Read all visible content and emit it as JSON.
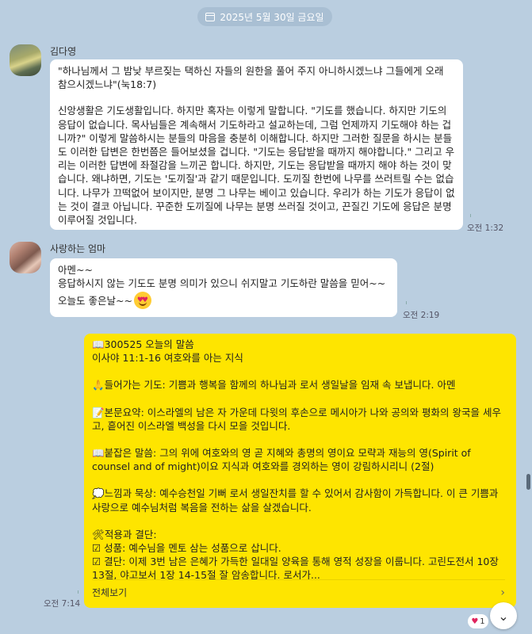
{
  "date_divider": "2025년 5월 30일 금요일",
  "messages": [
    {
      "sender": "김다영",
      "paragraphs": [
        "\"하나님께서 그 밤낮 부르짖는 택하신 자들의 원한을 풀어 주지 아니하시겠느냐 그들에게 오래 참으시겠느냐\"(눅18:7)",
        "신앙생활은 기도생활입니다. 하지만 혹자는 이렇게 말합니다. \"기도를 했습니다. 하지만 기도의 응답이 없습니다. 목사님들은 계속해서 기도하라고 설교하는데, 그럼 언제까지 기도해야 하는 겁니까?\" 이렇게 말씀하시는 분들의 마음을 충분히 이해합니다. 하지만 그러한 질문을 하시는 분들도 이러한 답변은 한번쯤은 들어보셨을 겁니다. \"기도는 응답받을 때까지 해야합니다.\" 그리고 우리는 이러한 답변에 좌절감을 느끼곤 합니다. 하지만, 기도는 응답받을 때까지 해야 하는 것이 맞습니다. 왜냐하면, 기도는 '도끼질'과 같기 때문입니다. 도끼질 한번에 나무를 쓰러트릴 수는 없습니다. 나무가 끄떡없어 보이지만, 분명 그 나무는 베이고 있습니다. 우리가 하는 기도가 응답이 없는 것이 결코 아닙니다. 꾸준한 도끼질에 나무는 분명 쓰러질 것이고, 끈질긴 기도에 응답은 분명 이루어질 것입니다."
      ],
      "time": "오전 1:32"
    },
    {
      "sender": "사랑하는 엄마",
      "lines": [
        "아멘~~",
        "응답하시지 않는 기도도 분명 의미가 있으니 쉬지말고 기도하란 말씀을 믿어~~",
        "오늘도 좋은날~~"
      ],
      "emoji": "heart-eyes-emoji",
      "time": "오전 2:19"
    },
    {
      "sender": "me",
      "lines": [
        "📖300525 오늘의 말씀",
        "이사야 11:1-16 여호와를 아는 지식"
      ],
      "sections": [
        "🙏들어가는 기도: 기쁨과 행복을 함께의 하나님과 로서 생일날을 임재 속 보냅니다. 아멘",
        "📝본문요약: 이스라엘의 남은 자 가운데 다윗의 후손으로 메시아가 나와 공의와 평화의 왕국을 세우고, 흩어진 이스라엘 백성을 다시 모을 것입니다.",
        "📖붙잡은 말씀: 그의 위에 여호와의 영 곧 지혜와 총명의 영이요 모략과 재능의 영(Spirit of counsel and of might)이요 지식과 여호와를 경외하는 영이 강림하시리니 (2절)",
        "💭느낌과 묵상: 예수승천일 기뻐 로서 생일잔치를 할 수 있어서 감사함이 가득합니다. 이 큰 기쁨과 사랑으로 예수님처럼 복음을 전하는 삶을 살겠습니다."
      ],
      "apply_title": "🛠적용과 결단:",
      "apply_items": [
        "☑ 성품: 예수님을 멘토 삼는 성품으로 삽니다.",
        "☑ 결단: 이제 3번 남은 은혜가 가득한 일대일 양육을 통해 영적 성장을 이룹니다. 고린도전서 10장 13절, 야고보서 1장 14-15절 잘 암송합니다. 로서가..."
      ],
      "more_label": "전체보기",
      "time": "오전 7:14",
      "reaction_count": "1"
    }
  ]
}
